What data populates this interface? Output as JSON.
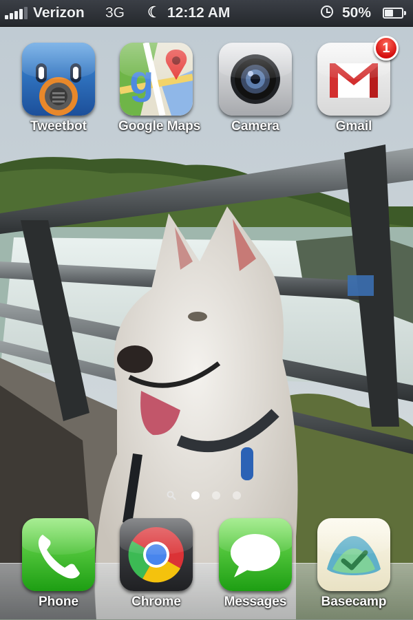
{
  "status_bar": {
    "carrier": "Verizon",
    "network": "3G",
    "time": "12:12 AM",
    "battery_percent": "50%",
    "battery_level": 0.5,
    "signal_bars": 4
  },
  "home": {
    "apps": [
      {
        "name": "Tweetbot",
        "icon": "tweetbot-icon"
      },
      {
        "name": "Google Maps",
        "icon": "google-maps-icon"
      },
      {
        "name": "Camera",
        "icon": "camera-icon"
      },
      {
        "name": "Gmail",
        "icon": "gmail-icon",
        "badge": "1"
      }
    ],
    "page_indicator": {
      "pages": 3,
      "current": 1,
      "has_search": true
    }
  },
  "dock": {
    "apps": [
      {
        "name": "Phone",
        "icon": "phone-icon"
      },
      {
        "name": "Chrome",
        "icon": "chrome-icon"
      },
      {
        "name": "Messages",
        "icon": "messages-icon"
      },
      {
        "name": "Basecamp",
        "icon": "basecamp-icon"
      }
    ]
  },
  "colors": {
    "badge_red": "#d40f0f",
    "status_bar": "#2c3036"
  }
}
